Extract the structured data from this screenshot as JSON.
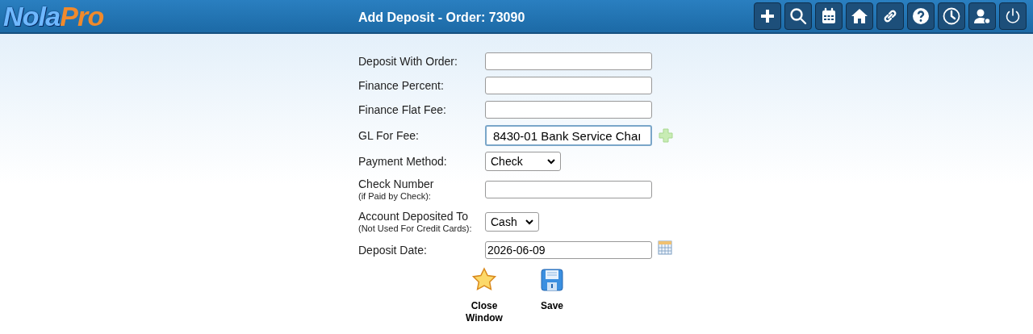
{
  "logo": {
    "part_1": "Nola",
    "part_2": "Pro"
  },
  "window": {
    "title": "Add Deposit - Order: 73090"
  },
  "fields": [
    {
      "kind": "text",
      "label": "Deposit With Order:",
      "focused": false
    },
    {
      "kind": "text",
      "label": "Finance Percent:",
      "focused": false
    },
    {
      "kind": "text",
      "label": "Finance Flat Fee:",
      "focused": false
    },
    {
      "kind": "account",
      "label": "GL For Fee:",
      "value": "8430-01 Bank Service Chaı",
      "focused": true
    },
    {
      "kind": "select",
      "label": "Payment Method:",
      "value": "Check",
      "focused": false
    },
    {
      "kind": "text",
      "label": "Check Number",
      "sublabel": "(if Paid by Check):",
      "focused": false
    },
    {
      "kind": "select",
      "label": "Account Deposited To",
      "sublabel": "(Not Used For Credit Cards):",
      "value": "Cash",
      "focused": false
    },
    {
      "kind": "date",
      "label": "Deposit Date:",
      "value": "2026-06-09",
      "focused": false
    }
  ],
  "actions": [
    {
      "kind": "close",
      "label": "Close\nWindow"
    },
    {
      "kind": "save",
      "label": "Save"
    }
  ]
}
